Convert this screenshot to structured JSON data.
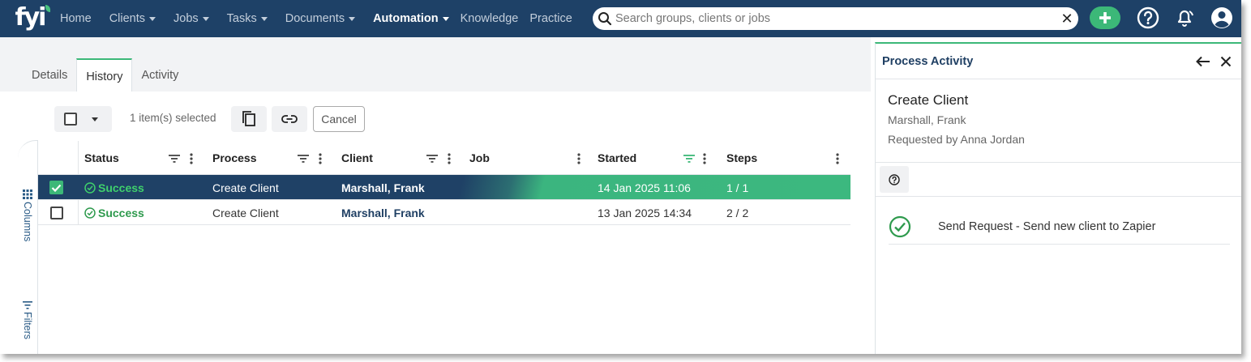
{
  "nav": {
    "logo": "fyi",
    "items": [
      {
        "label": "Home",
        "dropdown": false
      },
      {
        "label": "Clients",
        "dropdown": true
      },
      {
        "label": "Jobs",
        "dropdown": true
      },
      {
        "label": "Tasks",
        "dropdown": true
      },
      {
        "label": "Documents",
        "dropdown": true
      },
      {
        "label": "Automation",
        "dropdown": true,
        "active": true
      },
      {
        "label": "Knowledge",
        "dropdown": false
      },
      {
        "label": "Practice",
        "dropdown": false
      }
    ],
    "search_placeholder": "Search groups, clients or jobs",
    "icons": [
      "search-icon",
      "clear-icon",
      "plus-icon",
      "help-icon",
      "bell-icon",
      "user-icon"
    ]
  },
  "tabs": [
    {
      "label": "Details",
      "active": false
    },
    {
      "label": "History",
      "active": true
    },
    {
      "label": "Activity",
      "active": false
    }
  ],
  "toolbar": {
    "selected_count": "1 item(s) selected",
    "cancel_label": "Cancel",
    "icons": [
      "copy-icon",
      "link-icon"
    ]
  },
  "rail": {
    "columns_label": "Columns",
    "filters_label": "Filters"
  },
  "table": {
    "columns": [
      "Status",
      "Process",
      "Client",
      "Job",
      "Started",
      "Steps"
    ],
    "rows": [
      {
        "selected": true,
        "status": "Success",
        "process": "Create Client",
        "client": "Marshall, Frank",
        "job": "",
        "started": "14 Jan 2025 11:06",
        "steps": "1 / 1"
      },
      {
        "selected": false,
        "status": "Success",
        "process": "Create Client",
        "client": "Marshall, Frank",
        "job": "",
        "started": "13 Jan 2025 14:34",
        "steps": "2 / 2"
      }
    ]
  },
  "panel": {
    "title": "Process Activity",
    "process_name": "Create Client",
    "client": "Marshall, Frank",
    "requested_by": "Requested by Anna Jordan",
    "steps": [
      {
        "label": "Send Request - Send new client to Zapier",
        "status": "success"
      }
    ]
  },
  "colors": {
    "nav_bg": "#1e4167",
    "accent_green": "#3cb878",
    "selected_row": "#1f4166",
    "link_blue": "#1f3f63"
  }
}
